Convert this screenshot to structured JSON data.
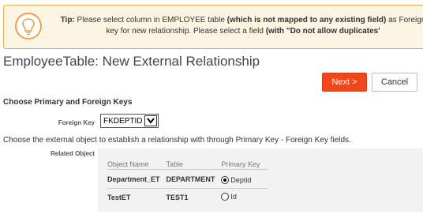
{
  "tip": {
    "icon": "lightbulb-icon",
    "label": "Tip:",
    "text1": " Please select column in EMPLOYEE table ",
    "bold1": "(which is not mapped to any existing field)",
    "text2": " as Foreign key for new relationship. Please select a field ",
    "bold2": "(with \"Do not allow duplicates'"
  },
  "page": {
    "title": "EmployeeTable: New External Relationship"
  },
  "toolbar": {
    "next_label": "Next >",
    "cancel_label": "Cancel"
  },
  "section": {
    "heading": "Choose Primary and Foreign Keys"
  },
  "foreign_key": {
    "label": "Foreign Key",
    "selected": "FKDEPTID"
  },
  "instruction": "Choose the external object to establish a relationship with through Primary Key - Foreign Key fields.",
  "related_object": {
    "label": "Related Object",
    "columns": [
      "Object Name",
      "Table",
      "Primary Key"
    ],
    "rows": [
      {
        "object_name": "Department_ET",
        "table": "DEPARTMENT",
        "primary_key": "Deptid",
        "selected": true
      },
      {
        "object_name": "TestET",
        "table": "TEST1",
        "primary_key": "Id",
        "selected": false
      }
    ]
  },
  "colors": {
    "accent": "#f2461c",
    "tip_border": "#f0ad4e",
    "tip_background": "#fdf5e3"
  }
}
